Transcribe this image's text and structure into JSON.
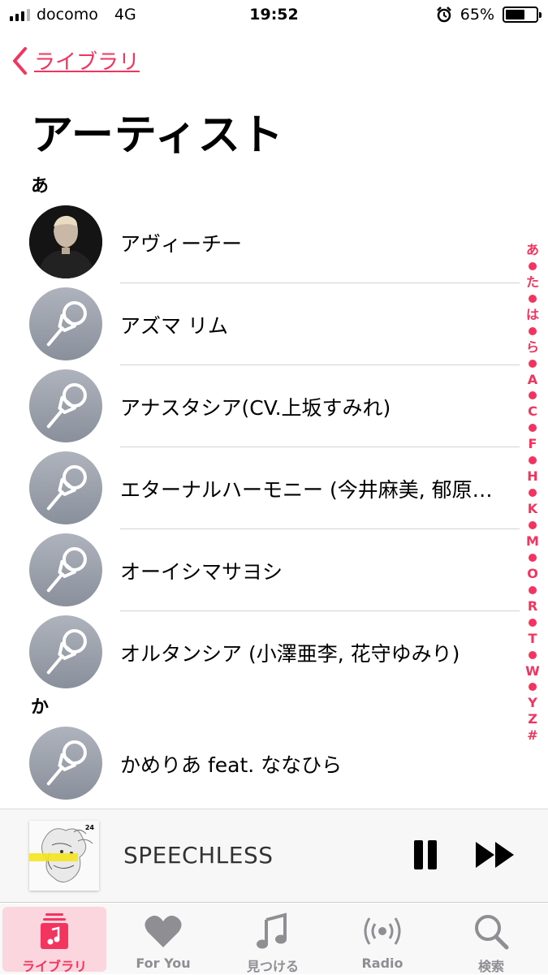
{
  "status_bar": {
    "carrier": "docomo",
    "network": "4G",
    "time": "19:52",
    "battery_percent": "65%",
    "battery_level": 0.65
  },
  "nav": {
    "back_label": "ライブラリ",
    "title": "アーティスト"
  },
  "sections": [
    {
      "header": "あ",
      "artists": [
        {
          "name": "アヴィーチー",
          "avatar": "photo"
        },
        {
          "name": "アズマ リム",
          "avatar": "microphone-icon"
        },
        {
          "name": "アナスタシア(CV.上坂すみれ)",
          "avatar": "microphone-icon"
        },
        {
          "name": "エターナルハーモニー (今井麻美, 郁原…",
          "avatar": "microphone-icon"
        },
        {
          "name": "オーイシマサヨシ",
          "avatar": "microphone-icon"
        },
        {
          "name": "オルタンシア (小澤亜李, 花守ゆみり)",
          "avatar": "microphone-icon"
        }
      ]
    },
    {
      "header": "か",
      "artists": [
        {
          "name": "かめりあ feat. ななひら",
          "avatar": "microphone-icon"
        }
      ]
    }
  ],
  "index": [
    "あ",
    "•",
    "た",
    "•",
    "は",
    "•",
    "ら",
    "•",
    "A",
    "•",
    "C",
    "•",
    "F",
    "•",
    "H",
    "•",
    "K",
    "•",
    "M",
    "•",
    "O",
    "•",
    "R",
    "•",
    "T",
    "•",
    "W",
    "•",
    "Y",
    "Z",
    "#"
  ],
  "now_playing": {
    "title": "SPEECHLESS",
    "art_label": "24"
  },
  "tabs": [
    {
      "label": "ライブラリ",
      "icon": "library-icon",
      "active": true
    },
    {
      "label": "For You",
      "icon": "heart-icon",
      "active": false
    },
    {
      "label": "見つける",
      "icon": "music-note-icon",
      "active": false
    },
    {
      "label": "Radio",
      "icon": "radio-icon",
      "active": false
    },
    {
      "label": "検索",
      "icon": "search-icon",
      "active": false
    }
  ],
  "colors": {
    "accent": "#f2345f",
    "active_tab_bg": "#fcd6de",
    "inactive": "#8e8e93"
  }
}
